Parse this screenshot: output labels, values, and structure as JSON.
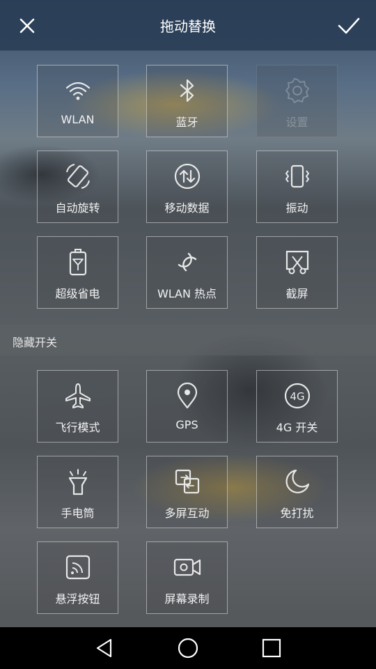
{
  "header": {
    "title": "拖动替换",
    "close_icon": "close-icon",
    "confirm_icon": "check-icon"
  },
  "active_tiles": [
    {
      "label": "WLAN",
      "icon": "wifi-icon",
      "enabled": true
    },
    {
      "label": "蓝牙",
      "icon": "bluetooth-icon",
      "enabled": true
    },
    {
      "label": "设置",
      "icon": "settings-icon",
      "enabled": false
    },
    {
      "label": "自动旋转",
      "icon": "auto-rotate-icon",
      "enabled": true
    },
    {
      "label": "移动数据",
      "icon": "mobile-data-icon",
      "enabled": true
    },
    {
      "label": "振动",
      "icon": "vibrate-icon",
      "enabled": true
    },
    {
      "label": "超级省电",
      "icon": "power-saver-icon",
      "enabled": true
    },
    {
      "label": "WLAN 热点",
      "icon": "hotspot-icon",
      "enabled": true
    },
    {
      "label": "截屏",
      "icon": "screenshot-icon",
      "enabled": true
    }
  ],
  "hidden_section": {
    "title": "隐藏开关"
  },
  "hidden_tiles": [
    {
      "label": "飞行模式",
      "icon": "airplane-icon"
    },
    {
      "label": "GPS",
      "icon": "location-icon"
    },
    {
      "label": "4G 开关",
      "icon": "4g-icon",
      "icon_text": "4G"
    },
    {
      "label": "手电筒",
      "icon": "flashlight-icon"
    },
    {
      "label": "多屏互动",
      "icon": "multi-screen-icon"
    },
    {
      "label": "免打扰",
      "icon": "moon-icon"
    },
    {
      "label": "悬浮按钮",
      "icon": "floating-button-icon"
    },
    {
      "label": "屏幕录制",
      "icon": "screen-record-icon"
    }
  ],
  "navbar": {
    "back_icon": "back-icon",
    "home_icon": "home-icon",
    "recents_icon": "recents-icon"
  }
}
